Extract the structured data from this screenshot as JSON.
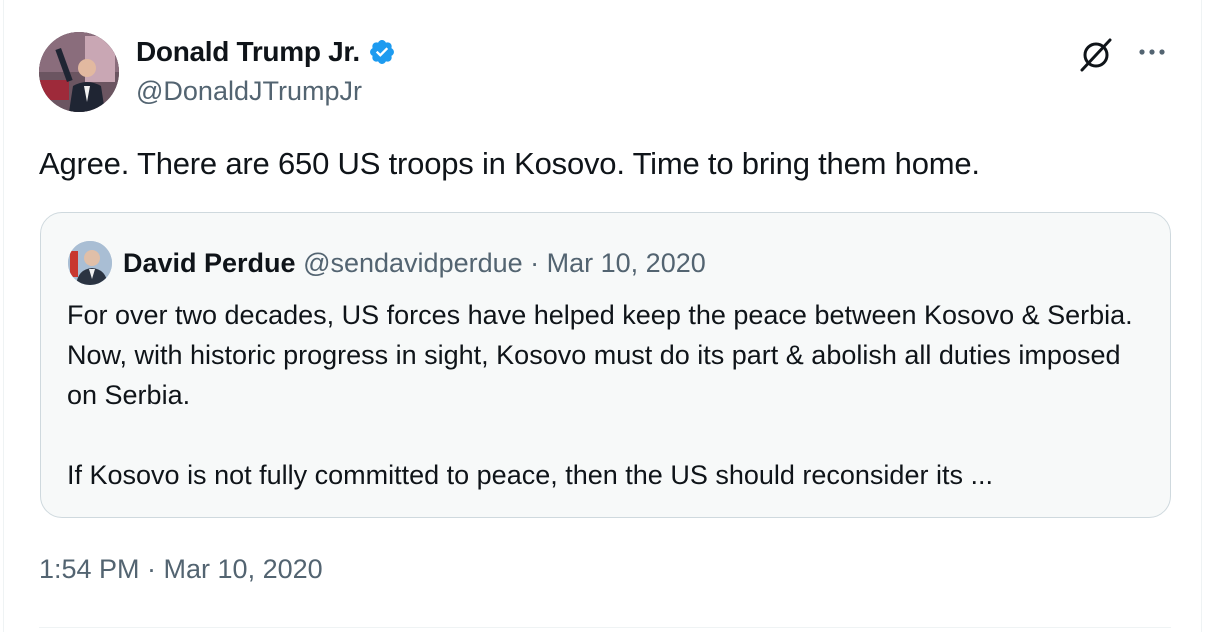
{
  "author": {
    "display_name": "Donald Trump Jr.",
    "handle": "@DonaldJTrumpJr",
    "verified": true,
    "avatar_icon": "profile-photo"
  },
  "actions": {
    "grok_icon": "grok-icon",
    "more_icon": "more-icon"
  },
  "tweet": {
    "text": "Agree. There are 650 US troops in Kosovo. Time to bring them home.",
    "timestamp": "1:54 PM · Mar 10, 2020"
  },
  "quoted": {
    "display_name": "David Perdue",
    "handle": "@sendavidperdue",
    "separator": " · ",
    "date": "Mar 10, 2020",
    "text": "For over two decades, US forces have helped keep the peace between Kosovo & Serbia. Now, with historic progress in sight, Kosovo must do its part & abolish all duties imposed on Serbia.\n\nIf Kosovo is not fully committed to peace, then the US should reconsider its ..."
  },
  "colors": {
    "text_primary": "#0f1419",
    "text_secondary": "#536471",
    "verified_blue": "#1d9bf0",
    "quote_bg": "#f7f9f9",
    "quote_border": "#cfd9de"
  }
}
